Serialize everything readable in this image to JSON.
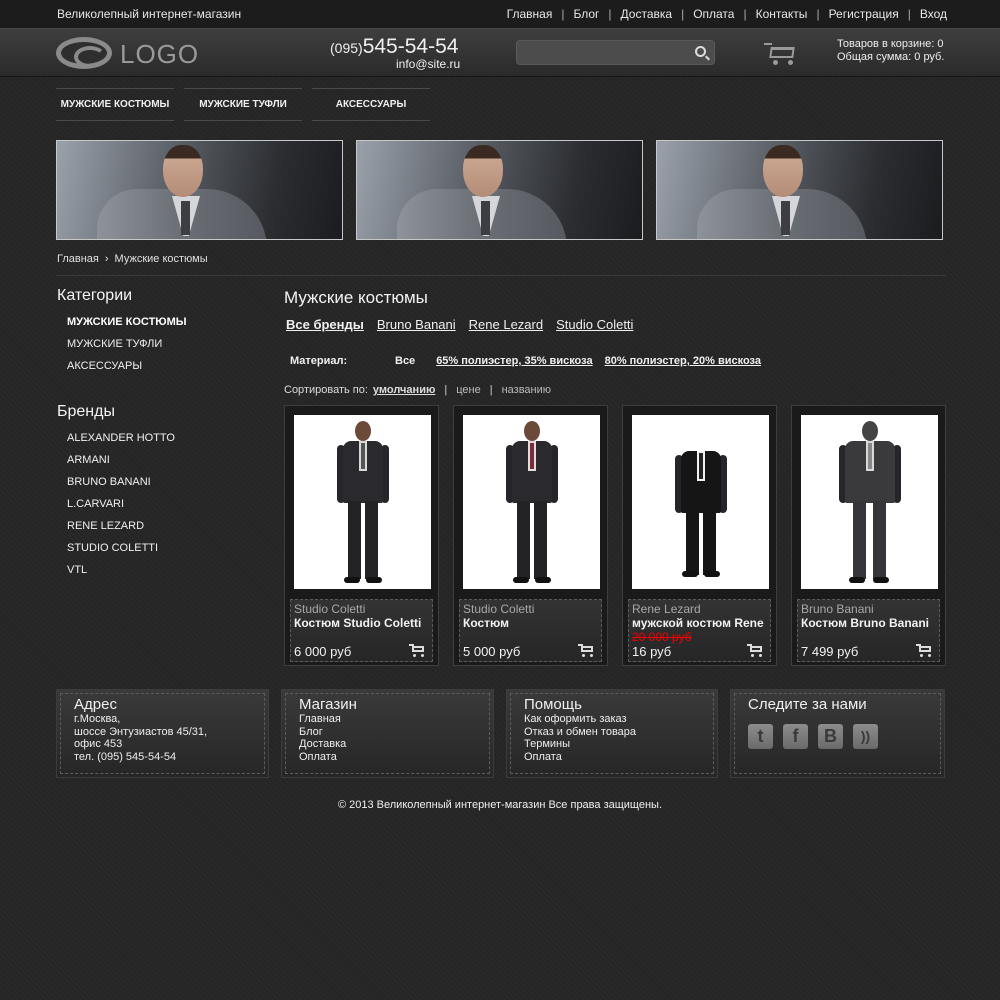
{
  "topbar": {
    "site_name": "Великолепный интернет-магазин",
    "nav": [
      "Главная",
      "Блог",
      "Доставка",
      "Оплата",
      "Контакты",
      "Регистрация",
      "Вход"
    ]
  },
  "header": {
    "logo_text": "LOGO",
    "phone_code": "(095)",
    "phone_number": "545-54-54",
    "email": "info@site.ru",
    "search_placeholder": "",
    "cart_count_text": "Товаров в корзине: 0",
    "cart_total_text": "Общая сумма: 0 руб."
  },
  "menu": [
    "МУЖСКИЕ КОСТЮМЫ",
    "МУЖСКИЕ ТУФЛИ",
    "АКСЕССУАРЫ"
  ],
  "breadcrumb": {
    "home": "Главная",
    "separator": "›",
    "current": "Мужские костюмы"
  },
  "sidebar": {
    "categories_title": "Категории",
    "categories": [
      "МУЖСКИЕ КОСТЮМЫ",
      "МУЖСКИЕ ТУФЛИ",
      "АКСЕССУАРЫ"
    ],
    "brands_title": "Бренды",
    "brands": [
      "ALEXANDER HOTTO",
      "ARMANI",
      "BRUNO BANANI",
      "L.CARVARI",
      "RENE LEZARD",
      "STUDIO COLETTI",
      "VTL"
    ]
  },
  "content": {
    "title": "Мужские костюмы",
    "brand_filter": [
      "Все бренды",
      "Bruno Banani",
      "Rene Lezard",
      "Studio Coletti"
    ],
    "material_label": "Материал:",
    "material_options": [
      "Все",
      "65% полиэстер, 35% вискоза",
      "80% полиэстер, 20% вискоза"
    ],
    "sort_label": "Сортировать по:",
    "sort_options": [
      "умолчанию",
      "цене",
      "названию"
    ]
  },
  "products": [
    {
      "brand": "Studio Coletti",
      "name": "Костюм Studio Coletti",
      "old_price": "",
      "price": "6 000 руб"
    },
    {
      "brand": "Studio Coletti",
      "name": "Костюм",
      "old_price": "",
      "price": "5 000 руб"
    },
    {
      "brand": "Rene Lezard",
      "name": "мужской костюм Rene",
      "old_price": "20 000 руб",
      "price": "16 руб"
    },
    {
      "brand": "Bruno Banani",
      "name": "Костюм Bruno Banani",
      "old_price": "",
      "price": "7 499 руб"
    }
  ],
  "footer": {
    "address_title": "Адрес",
    "address_lines": [
      "г.Москва,",
      "шоссе Энтузиастов 45/31,",
      "офис 453",
      "тел. (095) 545-54-54"
    ],
    "shop_title": "Магазин",
    "shop_links": [
      "Главная",
      "Блог",
      "Доставка",
      "Оплата"
    ],
    "help_title": "Помощь",
    "help_links": [
      "Как оформить заказ",
      "Отказ и обмен товара",
      "Термины",
      "Оплата"
    ],
    "follow_title": "Следите за нами",
    "social": [
      "twitter-icon",
      "facebook-icon",
      "vk-icon",
      "rss-icon"
    ],
    "copyright": "© 2013 Великолепный интернет-магазин Все права защищены."
  },
  "colors": {
    "background": "#262626",
    "old_price": "#e00000",
    "text": "#f0f0f0"
  }
}
